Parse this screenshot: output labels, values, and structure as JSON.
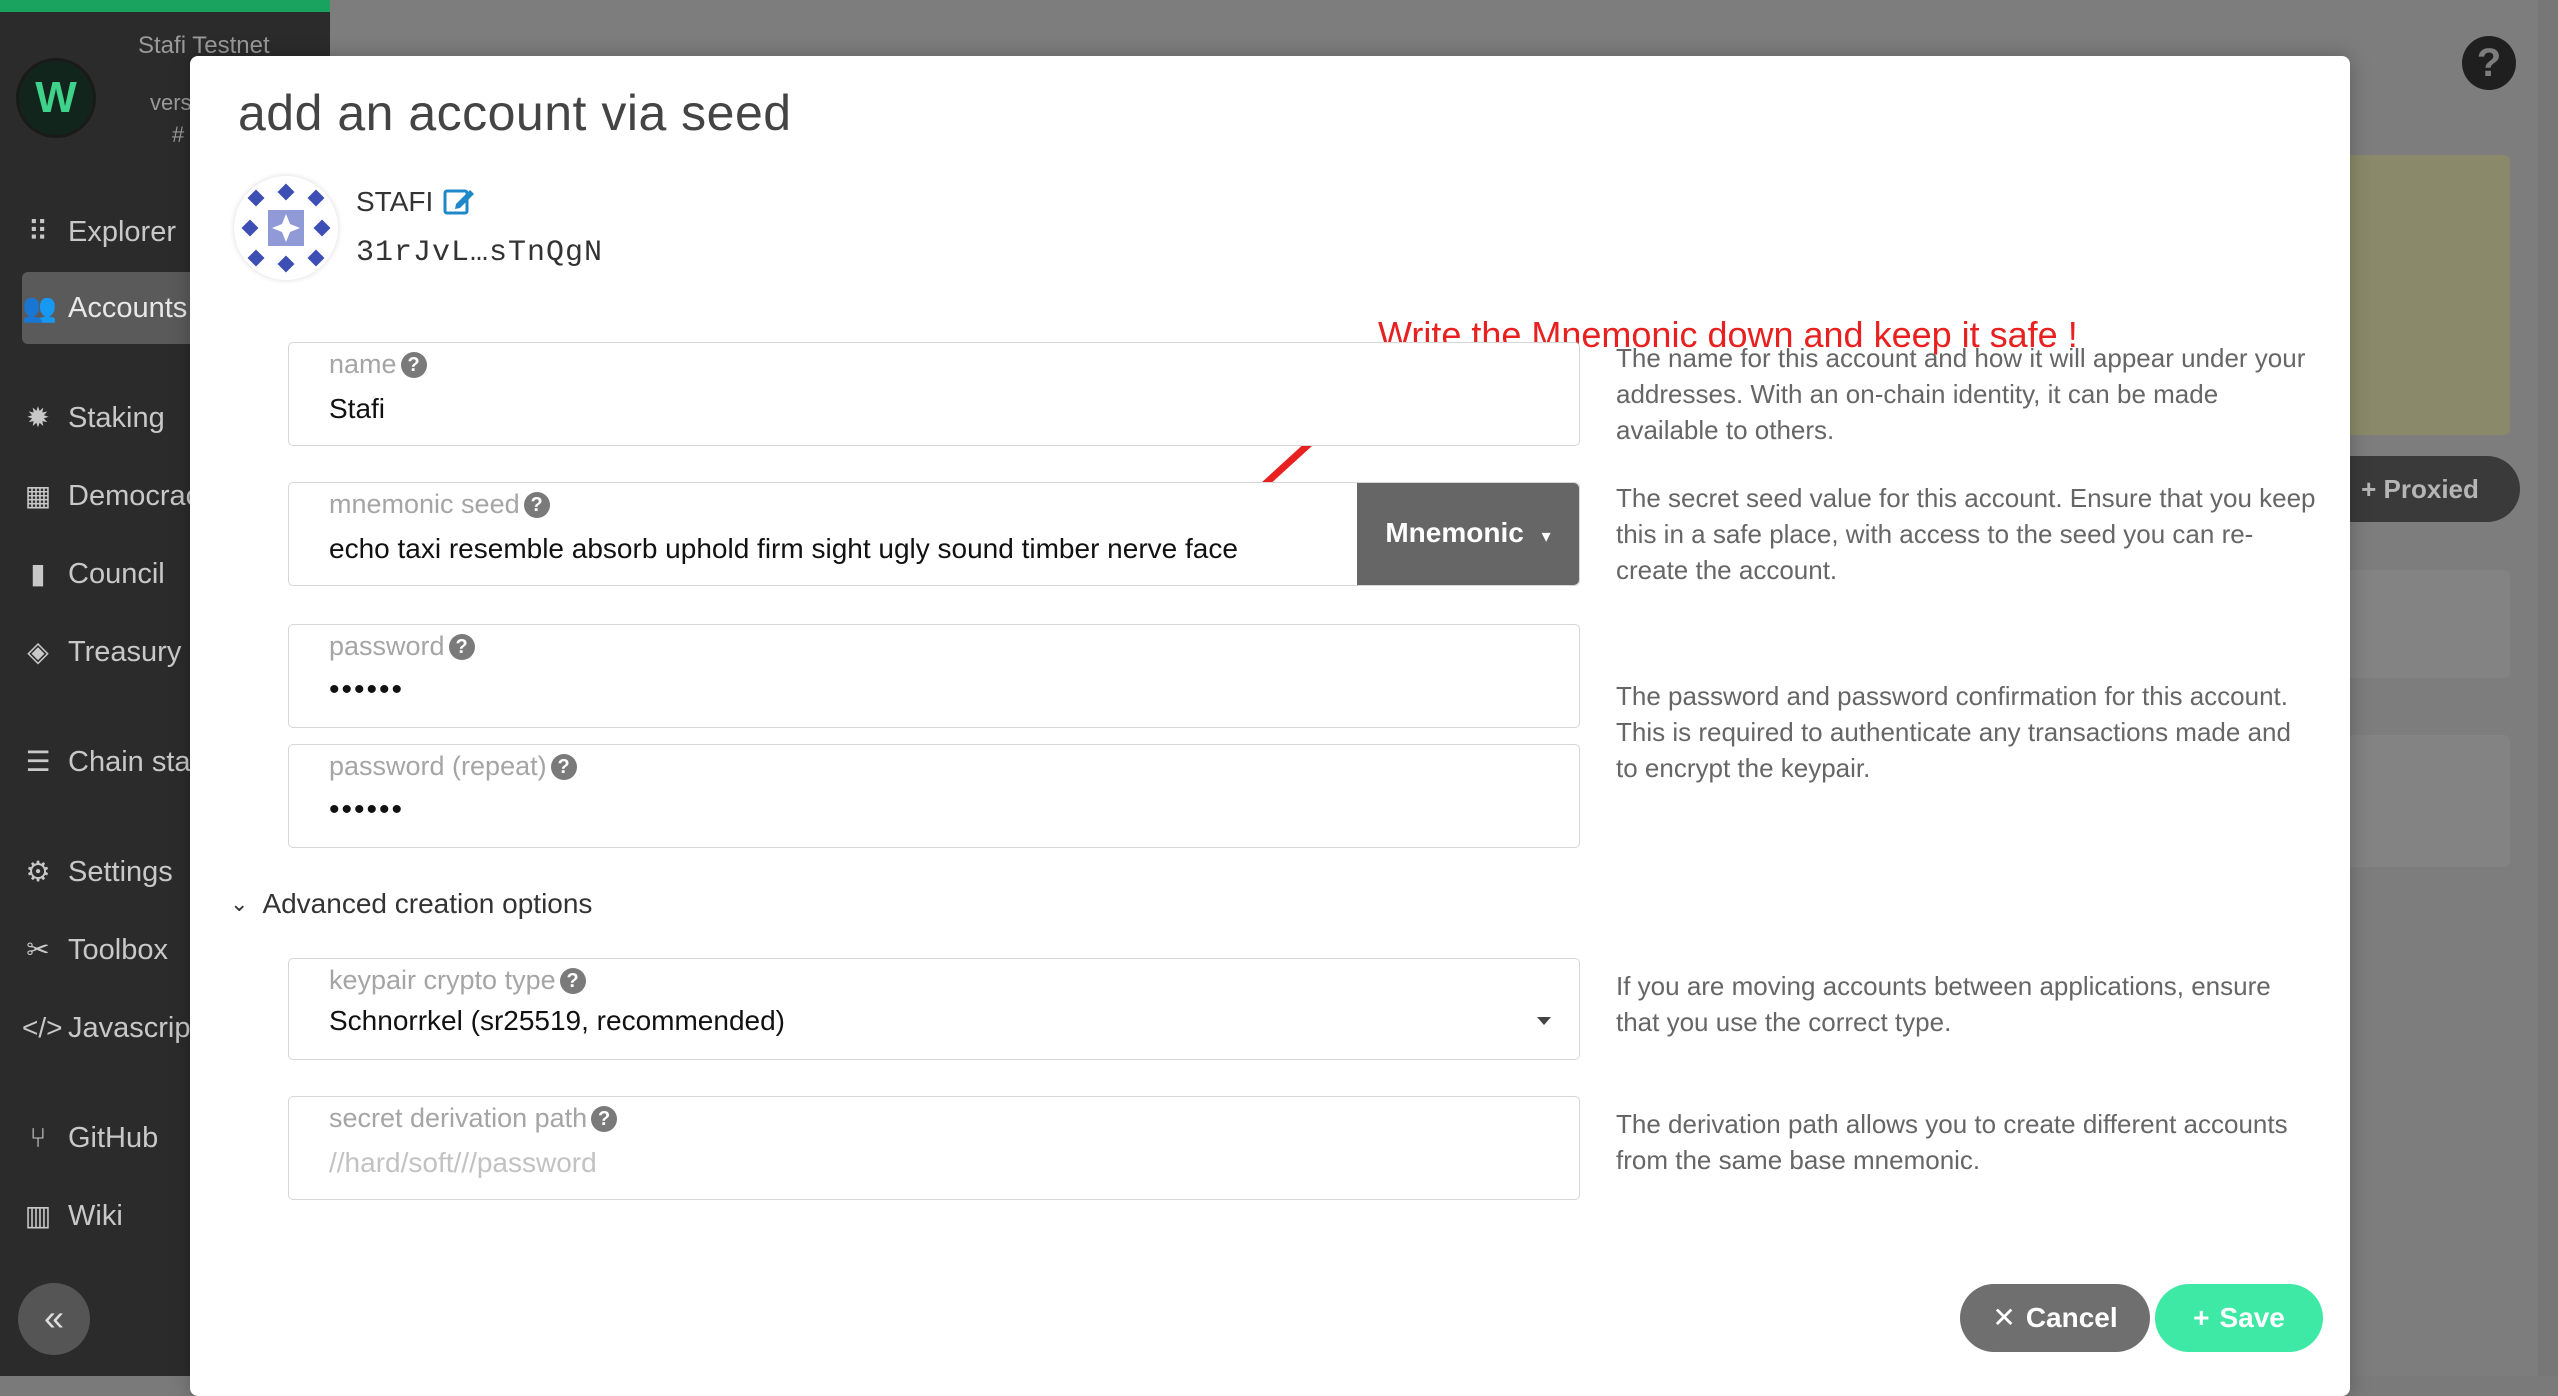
{
  "sidebar": {
    "network": "Stafi Testnet",
    "version_label": "vers",
    "hash_label": "#",
    "items": [
      {
        "label": "Explorer",
        "icon": "grid-icon"
      },
      {
        "label": "Accounts",
        "icon": "users-icon"
      },
      {
        "label": "Staking",
        "icon": "cog-badge-icon"
      },
      {
        "label": "Democracy",
        "icon": "calendar-icon"
      },
      {
        "label": "Council",
        "icon": "building-icon"
      },
      {
        "label": "Treasury",
        "icon": "gem-icon"
      },
      {
        "label": "Chain state",
        "icon": "database-icon"
      },
      {
        "label": "Settings",
        "icon": "cogs-icon"
      },
      {
        "label": "Toolbox",
        "icon": "tools-icon"
      },
      {
        "label": "Javascript",
        "icon": "code-icon"
      },
      {
        "label": "GitHub",
        "icon": "branch-icon"
      },
      {
        "label": "Wiki",
        "icon": "book-icon"
      }
    ]
  },
  "background": {
    "help_glyph": "?",
    "proxied_label": "+ Proxied"
  },
  "modal": {
    "title": "add an account via seed",
    "account": {
      "name": "STAFI",
      "address": "31rJvL…sTnQgN"
    },
    "annotation": "Write the Mnemonic down and keep it safe !",
    "fields": {
      "name": {
        "label": "name",
        "value": "Stafi",
        "help": "The name for this account and how it will appear under your addresses. With an on-chain identity, it can be made available to others."
      },
      "mnemonic": {
        "label": "mnemonic seed",
        "value": "echo taxi resemble absorb uphold firm sight ugly sound timber nerve face",
        "type_button": "Mnemonic",
        "help": "The secret seed value for this account. Ensure that you keep this in a safe place, with access to the seed you can re-create the account."
      },
      "password": {
        "label": "password",
        "value": "••••••"
      },
      "password_repeat": {
        "label": "password (repeat)",
        "value": "••••••"
      },
      "password_help": "The password and password confirmation for this account. This is required to authenticate any transactions made and to encrypt the keypair.",
      "advanced_toggle": "Advanced creation options",
      "crypto_type": {
        "label": "keypair crypto type",
        "value": "Schnorrkel (sr25519, recommended)",
        "help": "If you are moving accounts between applications, ensure that you use the correct type."
      },
      "derivation": {
        "label": "secret derivation path",
        "placeholder": "//hard/soft///password",
        "help": "The derivation path allows you to create different accounts from the same base mnemonic."
      }
    },
    "buttons": {
      "cancel": "Cancel",
      "save": "Save"
    },
    "colors": {
      "save": "#3ee8a5",
      "cancel": "#6f6f6f",
      "annotation": "#e8201f",
      "mnemonic_button": "#666666"
    }
  }
}
